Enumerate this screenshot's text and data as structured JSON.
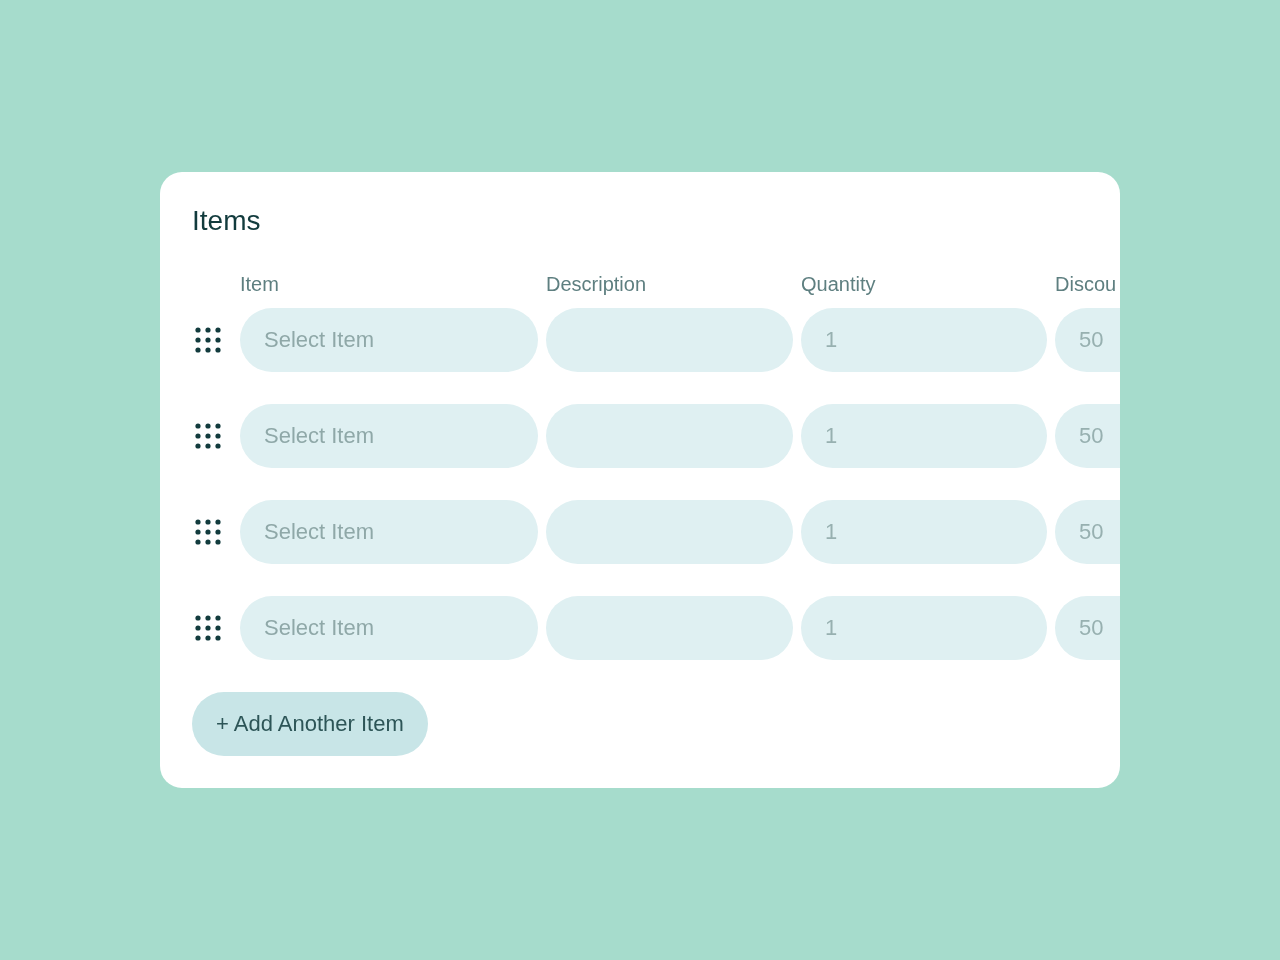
{
  "card": {
    "title": "Items"
  },
  "columns": [
    {
      "label": "Item",
      "kind": "select"
    },
    {
      "label": "Description",
      "kind": "text"
    },
    {
      "label": "Quantity",
      "kind": "number"
    },
    {
      "label": "Discou",
      "kind": "number"
    }
  ],
  "rows": [
    {
      "cells": [
        {
          "placeholder": "Select Item"
        },
        {},
        {
          "placeholder": "1"
        },
        {
          "placeholder": "50"
        }
      ]
    },
    {
      "cells": [
        {
          "placeholder": "Select Item"
        },
        {},
        {
          "placeholder": "1"
        },
        {
          "placeholder": "50"
        }
      ]
    },
    {
      "cells": [
        {
          "placeholder": "Select Item"
        },
        {},
        {
          "placeholder": "1"
        },
        {
          "placeholder": "50"
        }
      ]
    },
    {
      "cells": [
        {
          "placeholder": "Select Item"
        },
        {},
        {
          "placeholder": "1"
        },
        {
          "placeholder": "50"
        }
      ]
    }
  ],
  "add_button": {
    "label": "+ Add Another Item"
  }
}
